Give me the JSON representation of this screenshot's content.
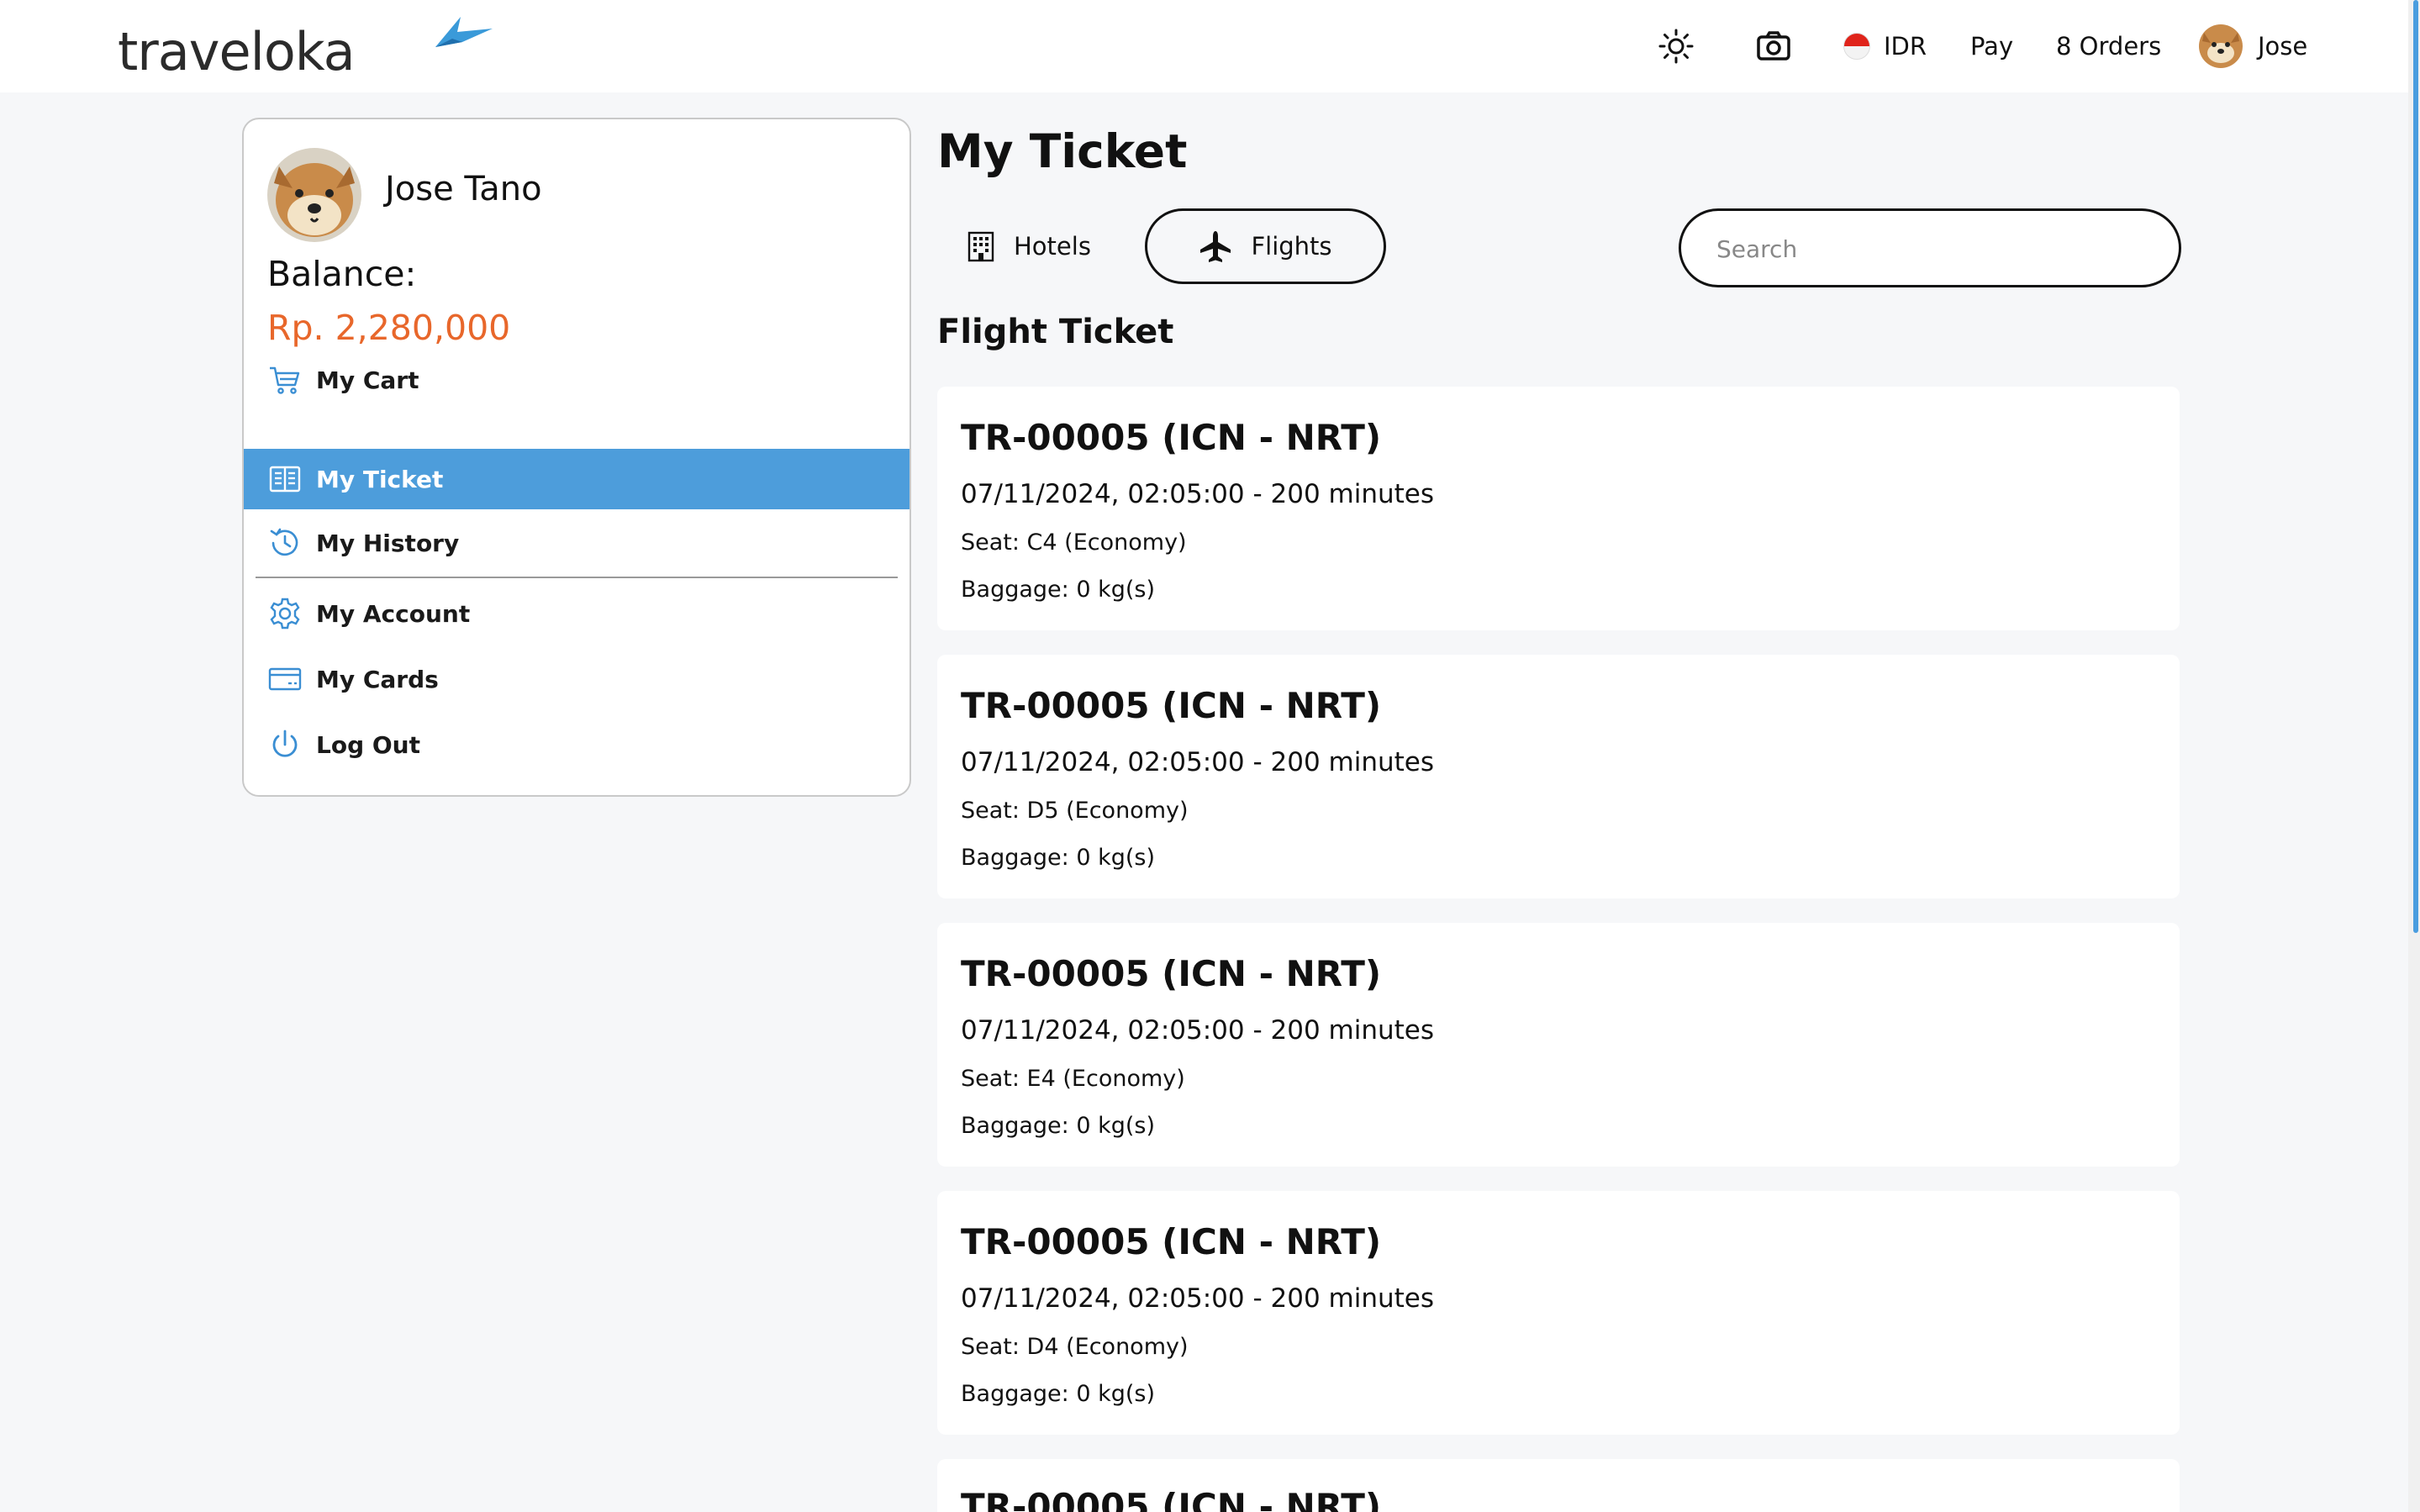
{
  "header": {
    "logo": "traveloka",
    "theme_icon": "sun-icon",
    "camera_icon": "camera-icon",
    "currency": "IDR",
    "pay_label": "Pay",
    "orders_label": "8 Orders",
    "user_name": "Jose"
  },
  "sidebar": {
    "profile_name": "Jose Tano",
    "balance_label": "Balance:",
    "balance_value": "Rp. 2,280,000",
    "items": [
      {
        "label": "My Cart",
        "icon": "cart-icon"
      },
      {
        "label": "My Ticket",
        "icon": "ticket-book-icon",
        "active": true
      },
      {
        "label": "My History",
        "icon": "history-icon"
      },
      {
        "label": "My Account",
        "icon": "gear-icon"
      },
      {
        "label": "My Cards",
        "icon": "card-icon"
      },
      {
        "label": "Log Out",
        "icon": "power-icon"
      }
    ]
  },
  "main": {
    "title": "My Ticket",
    "tabs": [
      {
        "label": "Hotels",
        "icon": "building-icon"
      },
      {
        "label": "Flights",
        "icon": "airplane-icon",
        "active": true
      }
    ],
    "search_placeholder": "Search",
    "section_title": "Flight Ticket",
    "tickets": [
      {
        "code": "TR-00005 (ICN - NRT)",
        "time": "07/11/2024, 02:05:00 - 200 minutes",
        "seat": "Seat: C4 (Economy)",
        "baggage": "Baggage: 0 kg(s)"
      },
      {
        "code": "TR-00005 (ICN - NRT)",
        "time": "07/11/2024, 02:05:00 - 200 minutes",
        "seat": "Seat: D5 (Economy)",
        "baggage": "Baggage: 0 kg(s)"
      },
      {
        "code": "TR-00005 (ICN - NRT)",
        "time": "07/11/2024, 02:05:00 - 200 minutes",
        "seat": "Seat: E4 (Economy)",
        "baggage": "Baggage: 0 kg(s)"
      },
      {
        "code": "TR-00005 (ICN - NRT)",
        "time": "07/11/2024, 02:05:00 - 200 minutes",
        "seat": "Seat: D4 (Economy)",
        "baggage": "Baggage: 0 kg(s)"
      },
      {
        "code": "TR-00005 (ICN - NRT)"
      }
    ]
  },
  "colors": {
    "accent": "#4d9ddb",
    "balance": "#e8672b",
    "page_bg": "#f6f7f9"
  }
}
